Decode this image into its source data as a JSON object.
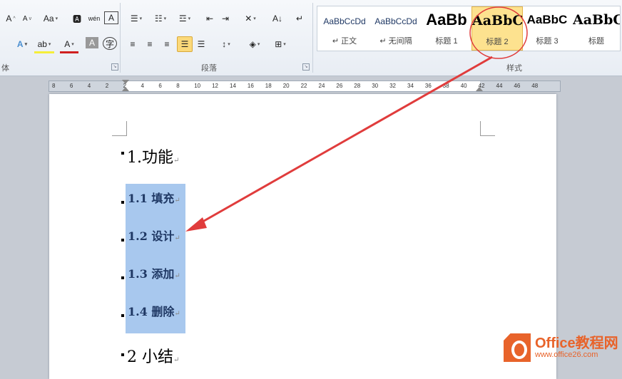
{
  "ribbon": {
    "font_group_label": "体",
    "paragraph_group_label": "段落",
    "styles_group_label": "样式"
  },
  "styles": [
    {
      "preview": "AaBbCcDd",
      "name": "↵ 正文"
    },
    {
      "preview": "AaBbCcDd",
      "name": "↵ 无间隔"
    },
    {
      "preview": "AaBb",
      "name": "标题 1"
    },
    {
      "preview": "AaBbC",
      "name": "标题 2",
      "active": true
    },
    {
      "preview": "AaBbC",
      "name": "标题 3"
    },
    {
      "preview": "AaBbC",
      "name": "标题"
    }
  ],
  "ruler": {
    "ticks": [
      "8",
      "6",
      "4",
      "2",
      "2",
      "4",
      "6",
      "8",
      "10",
      "12",
      "14",
      "16",
      "18",
      "20",
      "22",
      "24",
      "26",
      "28",
      "30",
      "32",
      "34",
      "36",
      "38",
      "40",
      "42",
      "44",
      "46",
      "48"
    ]
  },
  "document": {
    "h1": "1.功能",
    "items": [
      "1.1 填充",
      "1.2 设计",
      "1.3 添加",
      "1.4 删除"
    ],
    "h1b": "2 小结",
    "para_mark": "↵"
  },
  "watermark": {
    "line1": "Office教程网",
    "line2": "www.office26.com"
  },
  "colors": {
    "selection": "#a8c8ee",
    "annotation": "#e03c3c",
    "accent": "#e8632a"
  }
}
